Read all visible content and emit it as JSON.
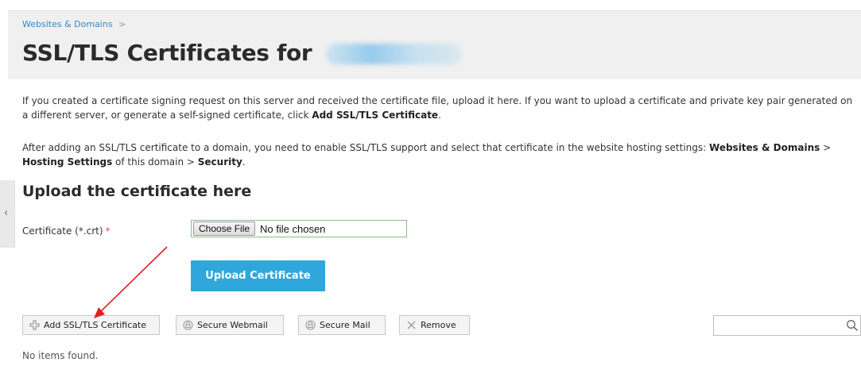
{
  "breadcrumb": {
    "item": "Websites & Domains",
    "separator": ">"
  },
  "header": {
    "title": "SSL/TLS Certificates for"
  },
  "intro": {
    "p1_text": "If you created a certificate signing request on this server and received the certificate file, upload it here. If you want to upload a certificate and private key pair generated on a different server, or generate a self-signed certificate, click ",
    "p1_bold": "Add SSL/TLS Certificate",
    "p1_end": ".",
    "p2_text": "After adding an SSL/TLS certificate to a domain, you need to enable SSL/TLS support and select that certificate in the website hosting settings: ",
    "p2_bold1": "Websites & Domains",
    "p2_sep1": " > ",
    "p2_bold2": "Hosting Settings",
    "p2_mid": " of this domain > ",
    "p2_bold3": "Security",
    "p2_end": "."
  },
  "upload": {
    "heading": "Upload the certificate here",
    "field_label": "Certificate (*.crt)",
    "required_mark": "*",
    "choose_file_label": "Choose File",
    "file_status": "No file chosen",
    "submit_label": "Upload Certificate"
  },
  "toolbar": {
    "add_label": "Add SSL/TLS Certificate",
    "webmail_label": "Secure Webmail",
    "mail_label": "Secure Mail",
    "remove_label": "Remove",
    "search_placeholder": ""
  },
  "list": {
    "empty_message": "No items found."
  },
  "icons": {
    "add": "plus-outline-icon",
    "webmail": "lock-circle-icon",
    "mail": "lock-circle-icon",
    "remove": "x-cross-icon",
    "search": "magnifier-icon",
    "collapse": "chevron-left-icon"
  },
  "colors": {
    "link": "#2f8bc9",
    "primary_button": "#2fa7db",
    "required": "#d9534f",
    "header_band": "#f0f0f0",
    "annotation_arrow": "#e02020"
  }
}
